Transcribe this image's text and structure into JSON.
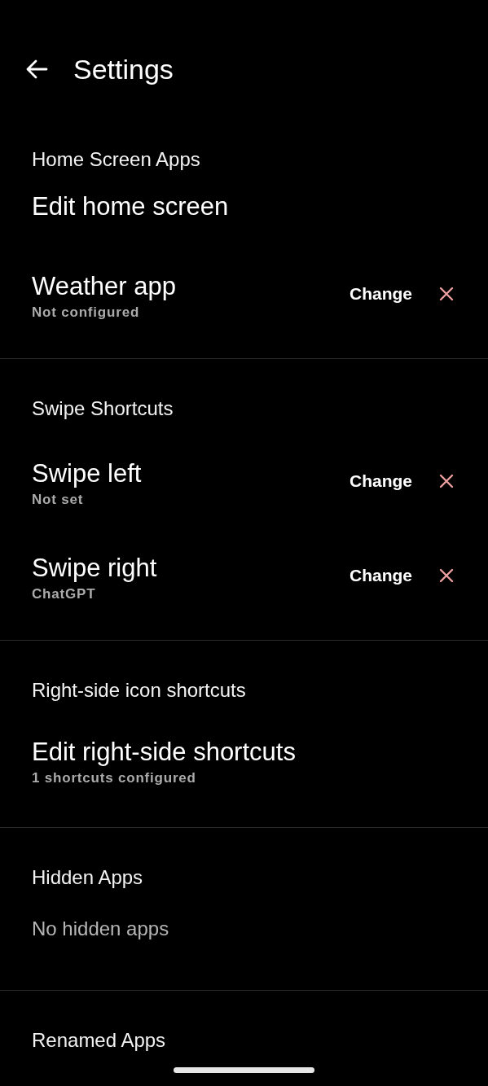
{
  "header": {
    "title": "Settings"
  },
  "sections": [
    {
      "title": "Home Screen Apps",
      "items": [
        {
          "kind": "link",
          "title": "Edit home screen"
        },
        {
          "kind": "app",
          "title": "Weather app",
          "subtitle": "Not configured",
          "action": "Change"
        }
      ]
    },
    {
      "title": "Swipe Shortcuts",
      "items": [
        {
          "kind": "app",
          "title": "Swipe left",
          "subtitle": "Not set",
          "action": "Change"
        },
        {
          "kind": "app",
          "title": "Swipe right",
          "subtitle": "ChatGPT",
          "action": "Change"
        }
      ]
    },
    {
      "title": "Right-side icon shortcuts",
      "items": [
        {
          "kind": "link",
          "title": "Edit right-side shortcuts",
          "subtitle": "1 shortcuts configured"
        }
      ]
    },
    {
      "title": "Hidden Apps",
      "items": [
        {
          "kind": "empty",
          "title": "No hidden apps"
        }
      ]
    },
    {
      "title": "Renamed Apps"
    }
  ]
}
